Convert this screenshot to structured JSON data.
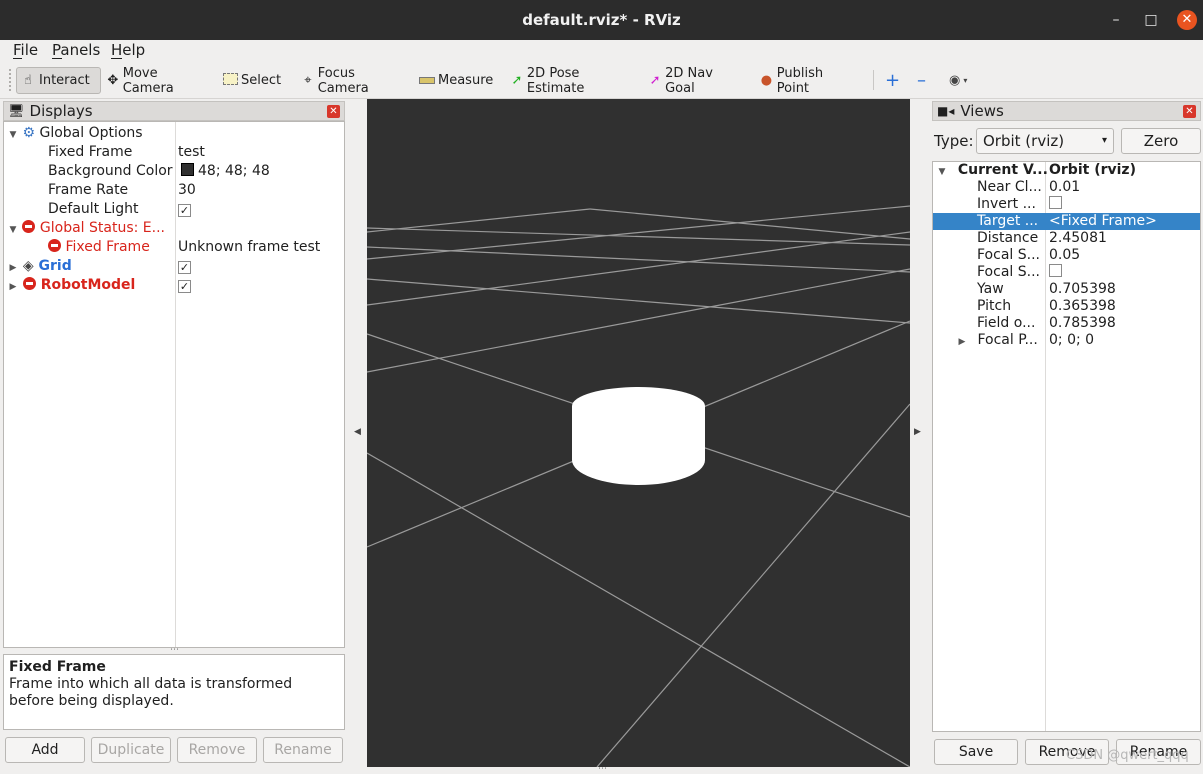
{
  "window": {
    "title": "default.rviz* - RViz",
    "minimize": "–",
    "maximize": "□",
    "close": "✕"
  },
  "menu": [
    {
      "label": "File"
    },
    {
      "label": "Panels"
    },
    {
      "label": "Help"
    }
  ],
  "toolbar": {
    "interact": "Interact",
    "move_camera": "Move Camera",
    "select": "Select",
    "focus_camera": "Focus Camera",
    "measure": "Measure",
    "pose_estimate": "2D Pose Estimate",
    "nav_goal": "2D Nav Goal",
    "publish_point": "Publish Point",
    "colors": {
      "pose_estimate": "#22b022",
      "nav_goal": "#d01fd0",
      "publish_point": "#c8542a",
      "add_tool": "#2a6fd6"
    }
  },
  "displays": {
    "title": "Displays",
    "global_options": "Global Options",
    "fixed_frame_label": "Fixed Frame",
    "fixed_frame_value": "test",
    "background_color_label": "Background Color",
    "background_color_value": "48; 48; 48",
    "frame_rate_label": "Frame Rate",
    "frame_rate_value": "30",
    "default_light_label": "Default Light",
    "default_light_checked": true,
    "global_status": "Global Status: E...",
    "status_fixed_frame": "Fixed Frame",
    "status_fixed_frame_value": "Unknown frame test",
    "grid": "Grid",
    "grid_checked": true,
    "robot_model": "RobotModel",
    "robot_model_checked": true,
    "colors": {
      "error": "#d8251c",
      "grid_label": "#2a6fd6"
    }
  },
  "description": {
    "title": "Fixed Frame",
    "body": "Frame into which all data is transformed before being displayed."
  },
  "display_buttons": {
    "add": "Add",
    "duplicate": "Duplicate",
    "remove": "Remove",
    "rename": "Rename"
  },
  "views": {
    "title": "Views",
    "type_label": "Type:",
    "type_value": "Orbit (rviz)",
    "zero": "Zero",
    "current_view_label": "Current V...",
    "current_view_value": "Orbit (rviz)",
    "rows": [
      {
        "label": "Near Cl...",
        "value": "0.01"
      },
      {
        "label": "Invert ...",
        "value": ""
      },
      {
        "label": "Target ...",
        "value": "<Fixed Frame>"
      },
      {
        "label": "Distance",
        "value": "2.45081"
      },
      {
        "label": "Focal S...",
        "value": "0.05"
      },
      {
        "label": "Focal S...",
        "value": ""
      },
      {
        "label": "Yaw",
        "value": "0.705398"
      },
      {
        "label": "Pitch",
        "value": "0.365398"
      },
      {
        "label": "Field o...",
        "value": "0.785398"
      },
      {
        "label": "Focal P...",
        "value": "0; 0; 0"
      }
    ],
    "selected_color": "#3584c8"
  },
  "view_buttons": {
    "save": "Save",
    "remove": "Remove",
    "rename": "Rename"
  },
  "watermark": "CSDN @qwert_qqq",
  "scene": {
    "background": "#303030",
    "grid_color": "#9a9a9a",
    "cylinder_color": "#ffffff"
  }
}
